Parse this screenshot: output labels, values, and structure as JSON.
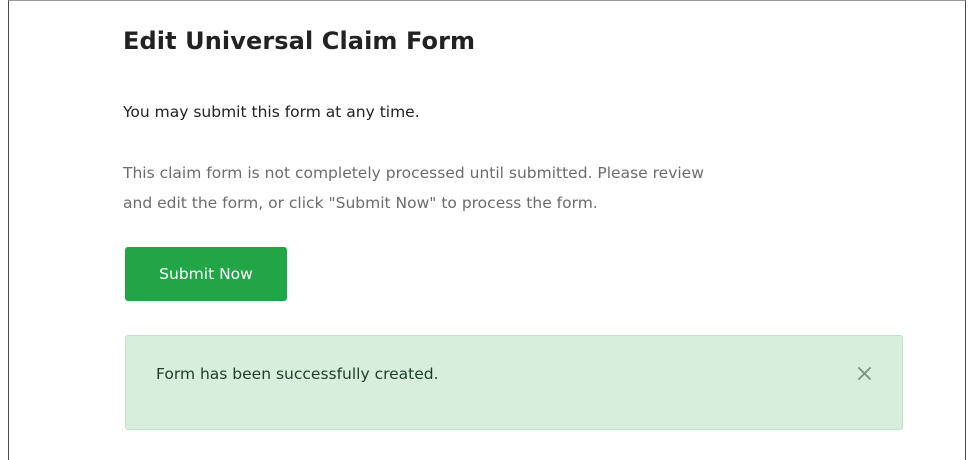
{
  "page": {
    "title": "Edit Universal Claim Form",
    "intro": "You may submit this form at any time.",
    "note_line1": "This claim form is not completely processed until submitted. Please review",
    "note_line2": "and edit the form, or click \"Submit Now\" to process the form.",
    "submit_label": "Submit Now"
  },
  "alert": {
    "message": "Form has been successfully created.",
    "close_icon": "close-icon",
    "background": "#d6eedb"
  },
  "colors": {
    "submit_button": "#22a547",
    "title_text": "#222222",
    "muted_text": "#6c6c6c"
  }
}
